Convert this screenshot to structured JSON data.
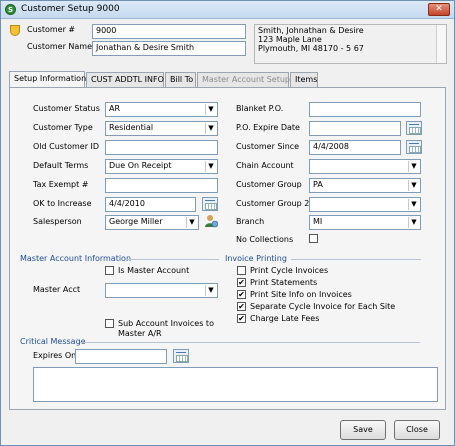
{
  "window": {
    "title": "Customer Setup 9000",
    "close_glyph": "✕"
  },
  "header": {
    "customer_num_label": "Customer #",
    "customer_num_value": "9000",
    "customer_name_label": "Customer Name",
    "customer_name_value": "Jonathan & Desire Smith",
    "address_lines": [
      "Smith, Johnathan & Desire",
      "123 Maple Lane",
      "Plymouth, MI 48170 - 5 67"
    ]
  },
  "tabs": [
    {
      "label": "Setup Information",
      "state": "active"
    },
    {
      "label": "CUST ADDTL INFO",
      "state": "normal"
    },
    {
      "label": "Bill To",
      "state": "normal"
    },
    {
      "label": "Master Account Setup",
      "state": "disabled"
    },
    {
      "label": "Items",
      "state": "normal"
    }
  ],
  "left_fields": {
    "customer_status": {
      "label": "Customer Status",
      "value": "AR"
    },
    "customer_type": {
      "label": "Customer Type",
      "value": "Residential"
    },
    "old_customer_id": {
      "label": "Old Customer ID",
      "value": ""
    },
    "default_terms": {
      "label": "Default Terms",
      "value": "Due On Receipt"
    },
    "tax_exempt": {
      "label": "Tax Exempt #",
      "value": ""
    },
    "ok_to_increase": {
      "label": "OK to Increase",
      "value": "4/4/2010"
    },
    "salesperson": {
      "label": "Salesperson",
      "value": "George Miller"
    }
  },
  "right_fields": {
    "blanket_po": {
      "label": "Blanket P.O.",
      "value": ""
    },
    "po_expire": {
      "label": "P.O. Expire Date",
      "value": ""
    },
    "customer_since": {
      "label": "Customer Since",
      "value": "4/4/2008"
    },
    "chain_account": {
      "label": "Chain Account",
      "value": ""
    },
    "customer_group": {
      "label": "Customer Group",
      "value": "PA"
    },
    "customer_group_2": {
      "label": "Customer Group 2",
      "value": ""
    },
    "branch": {
      "label": "Branch",
      "value": "MI"
    },
    "no_collections": {
      "label": "No Collections",
      "checked": false
    }
  },
  "master_account": {
    "title": "Master Account Information",
    "is_master_label": "Is Master Account",
    "is_master_checked": false,
    "master_acct_label": "Master Acct",
    "master_acct_value": "",
    "sub_invoices_label_1": "Sub Account Invoices to",
    "sub_invoices_label_2": "Master A/R",
    "sub_invoices_checked": false
  },
  "invoice_printing": {
    "title": "Invoice Printing",
    "options": [
      {
        "label": "Print Cycle Invoices",
        "checked": false
      },
      {
        "label": "Print Statements",
        "checked": true
      },
      {
        "label": "Print Site Info on Invoices",
        "checked": true
      },
      {
        "label": "Separate Cycle Invoice for Each Site",
        "checked": true
      },
      {
        "label": "Charge Late Fees",
        "checked": true
      }
    ]
  },
  "critical_message": {
    "title": "Critical Message",
    "expires_label": "Expires On",
    "expires_value": "",
    "message": ""
  },
  "buttons": {
    "save": "Save",
    "close": "Close"
  }
}
